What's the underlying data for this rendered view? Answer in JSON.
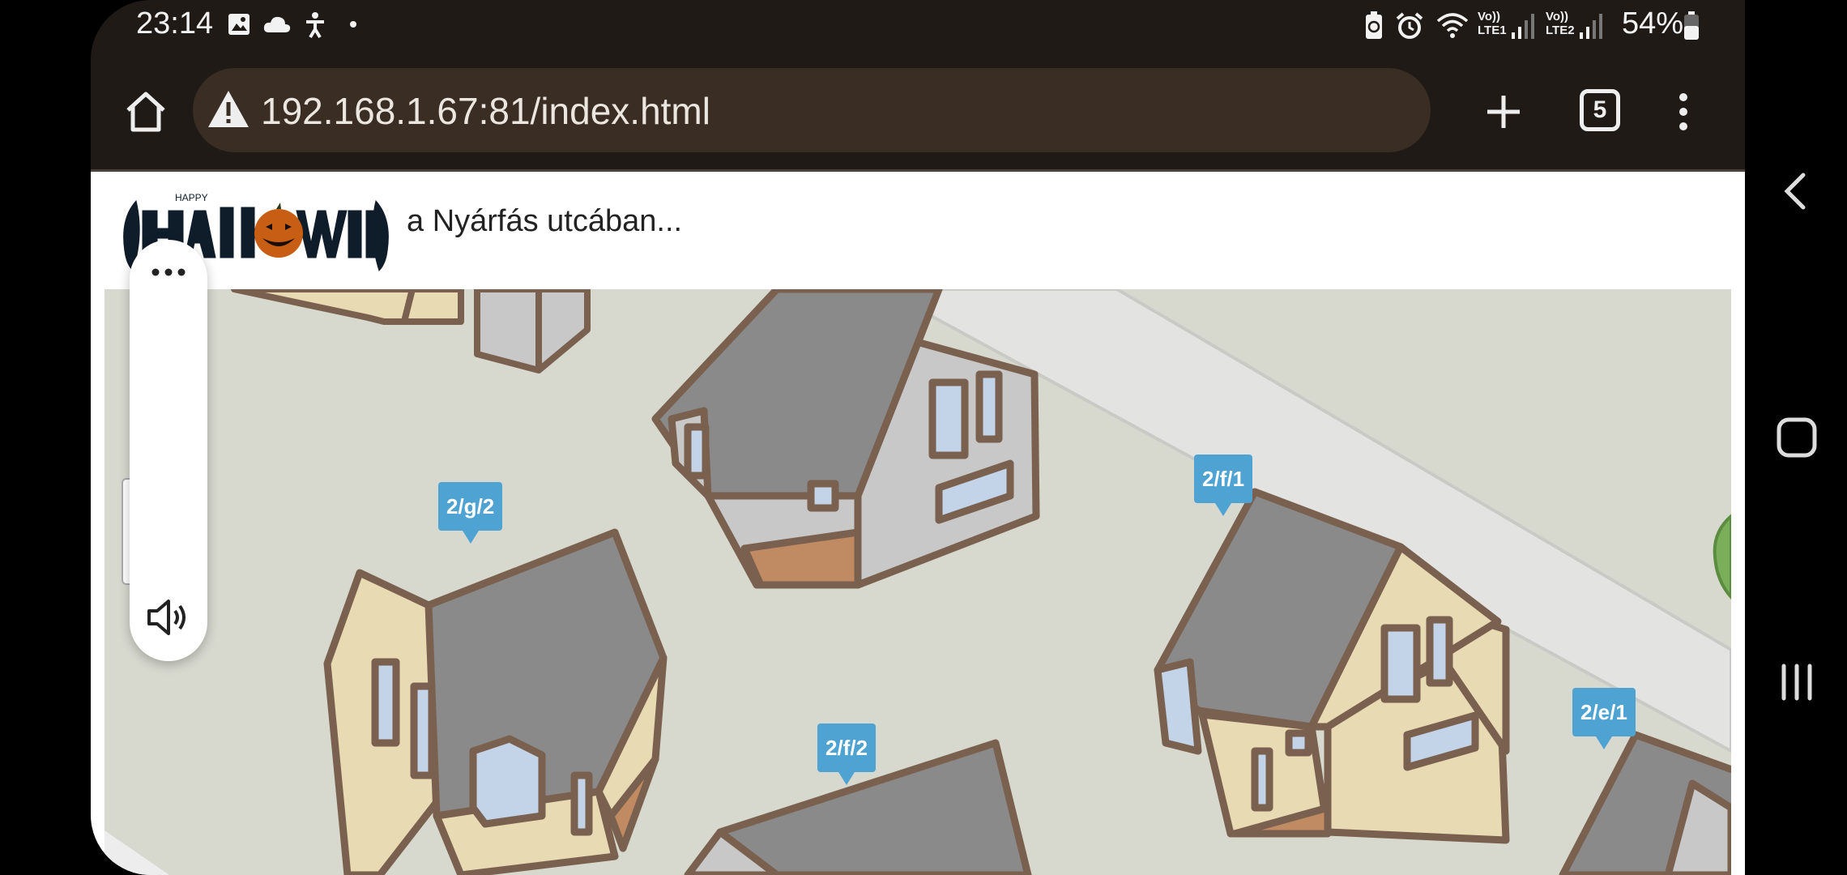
{
  "status_bar": {
    "time": "23:14",
    "left_icons": [
      "image-icon",
      "cloud-icon",
      "accessibility-icon",
      "dot-icon"
    ],
    "right_icons": [
      "battery-saver-icon",
      "alarm-icon",
      "wifi-icon",
      "signal-lte1-icon",
      "signal-lte2-icon",
      "battery-icon"
    ],
    "lte1_label": "Vo)) LTE1",
    "lte2_label": "Vo)) LTE2",
    "battery": "54%"
  },
  "browser": {
    "url": "192.168.1.67:81/index.html",
    "security_icon": "warning-icon",
    "tab_count": "5",
    "home_icon": "home-icon",
    "new_tab_icon": "plus-icon",
    "menu_icon": "more-vert-icon"
  },
  "site": {
    "logo_text": "HAPPY HALLOWEEN",
    "subtitle": "a Nyárfás utcában..."
  },
  "map": {
    "markers": [
      {
        "label": "2/g/2"
      },
      {
        "label": "2/f/1"
      },
      {
        "label": "2/f/2"
      },
      {
        "label": "2/e/1"
      }
    ]
  },
  "side_pill": {
    "more_icon": "more-horiz-icon",
    "sound_icon": "volume-icon"
  },
  "nav": {
    "back_icon": "back-icon",
    "home_icon": "home-square-icon",
    "recents_icon": "recents-icon"
  }
}
